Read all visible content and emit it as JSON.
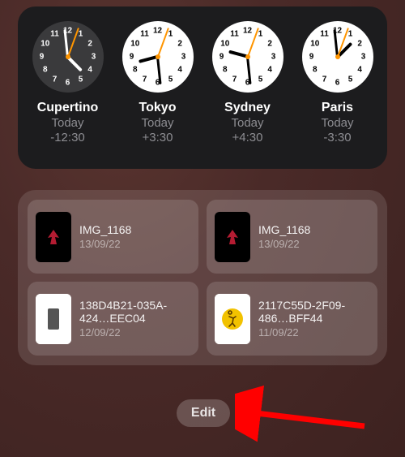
{
  "world_clock": {
    "items": [
      {
        "city": "Cupertino",
        "day": "Today",
        "offset": "-12:30",
        "face": "dark",
        "hour_angle": 135,
        "minute_angle": 354,
        "second_angle": 20
      },
      {
        "city": "Tokyo",
        "day": "Today",
        "offset": "+3:30",
        "face": "light",
        "hour_angle": 255,
        "minute_angle": 174,
        "second_angle": 20
      },
      {
        "city": "Sydney",
        "day": "Today",
        "offset": "+4:30",
        "face": "light",
        "hour_angle": 285,
        "minute_angle": 174,
        "second_angle": 20
      },
      {
        "city": "Paris",
        "day": "Today",
        "offset": "-3:30",
        "face": "light",
        "hour_angle": 405,
        "minute_angle": 354,
        "second_angle": 20
      }
    ]
  },
  "files": {
    "items": [
      {
        "name": "IMG_1168",
        "date": "13/09/22",
        "thumb": "phone-dark",
        "multiline": false
      },
      {
        "name": "IMG_1168",
        "date": "13/09/22",
        "thumb": "phone-dark",
        "multiline": false
      },
      {
        "name": "138D4B21-035A-424…EEC04",
        "date": "12/09/22",
        "thumb": "gray-block",
        "multiline": true
      },
      {
        "name": "2117C55D-2F09-486…BFF44",
        "date": "11/09/22",
        "thumb": "yellow-runner",
        "multiline": true
      }
    ]
  },
  "edit_button": {
    "label": "Edit"
  },
  "annotation": {
    "arrow_color": "#ff0000"
  }
}
